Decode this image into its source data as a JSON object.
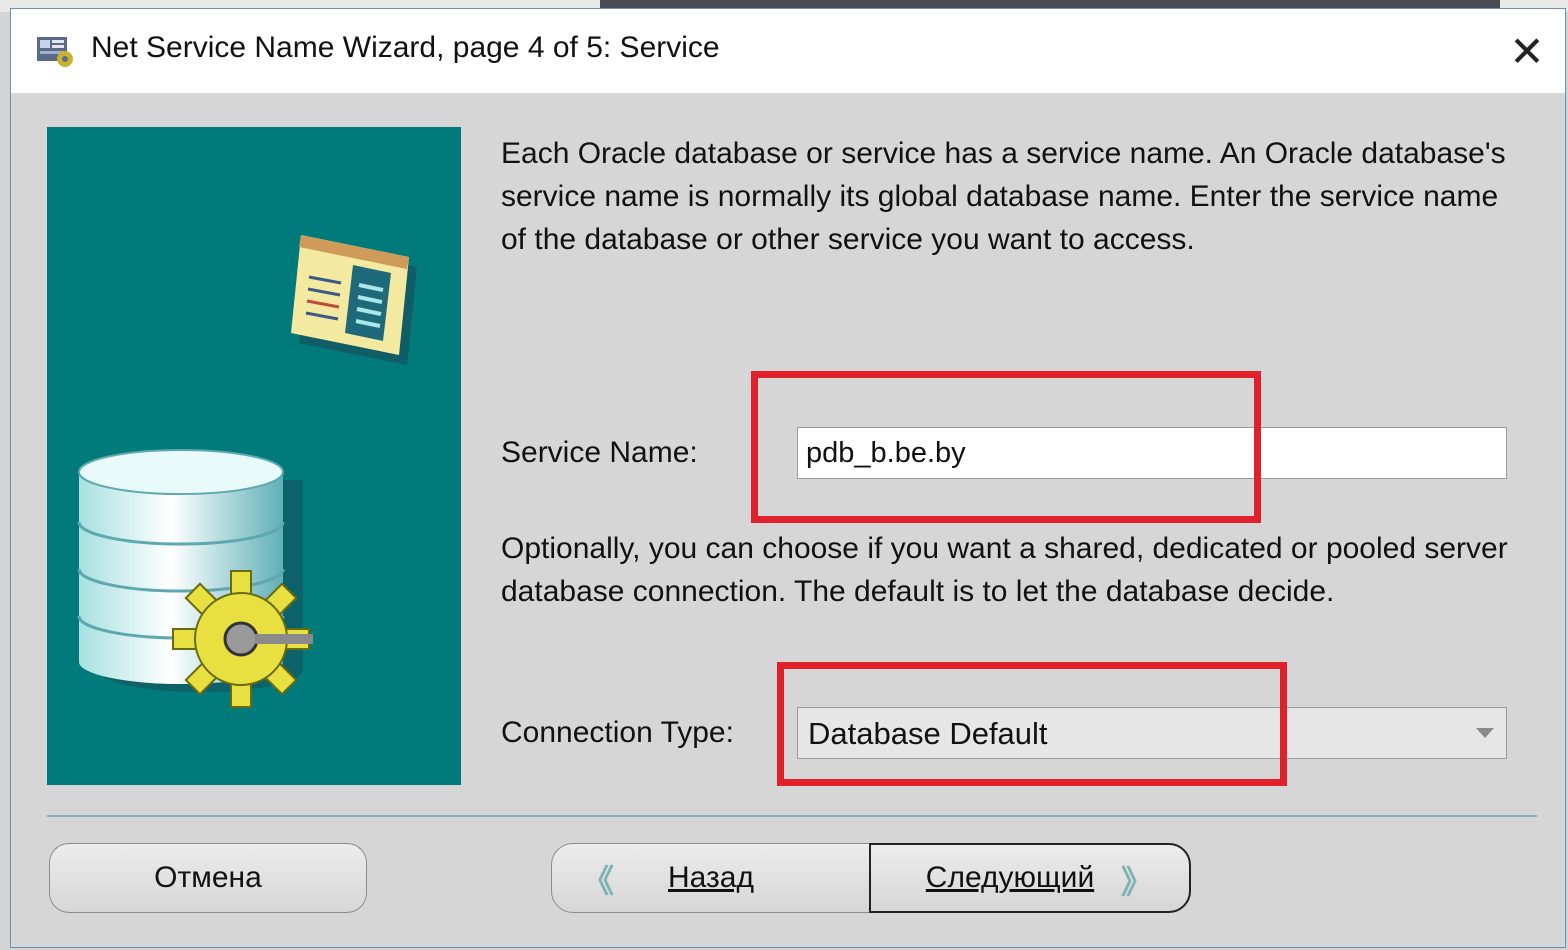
{
  "window": {
    "title": "Net Service Name Wizard, page 4 of 5: Service",
    "close_glyph": "✕"
  },
  "content": {
    "intro": "Each Oracle database or service has a service name. An Oracle database's service name is normally its global database name. Enter the service name of the database or other service you want to access.",
    "service_name_label": "Service Name:",
    "service_name_value": "pdb_b.be.by",
    "connection_text": "Optionally, you can choose if you want a shared, dedicated or pooled server database connection. The default is to let the database decide.",
    "connection_type_label": "Connection Type:",
    "connection_type_value": "Database Default"
  },
  "buttons": {
    "cancel": "Отмена",
    "back": "Назад",
    "next": "Следующий"
  },
  "colors": {
    "illustration_bg": "#007a7a",
    "highlight": "#e0202a",
    "accent_chevron": "#7fb2b2"
  },
  "icons": {
    "title": "wizard-app-icon",
    "back": "chevron-left-icon",
    "next": "chevron-right-icon",
    "dropdown": "dropdown-arrow-icon"
  }
}
